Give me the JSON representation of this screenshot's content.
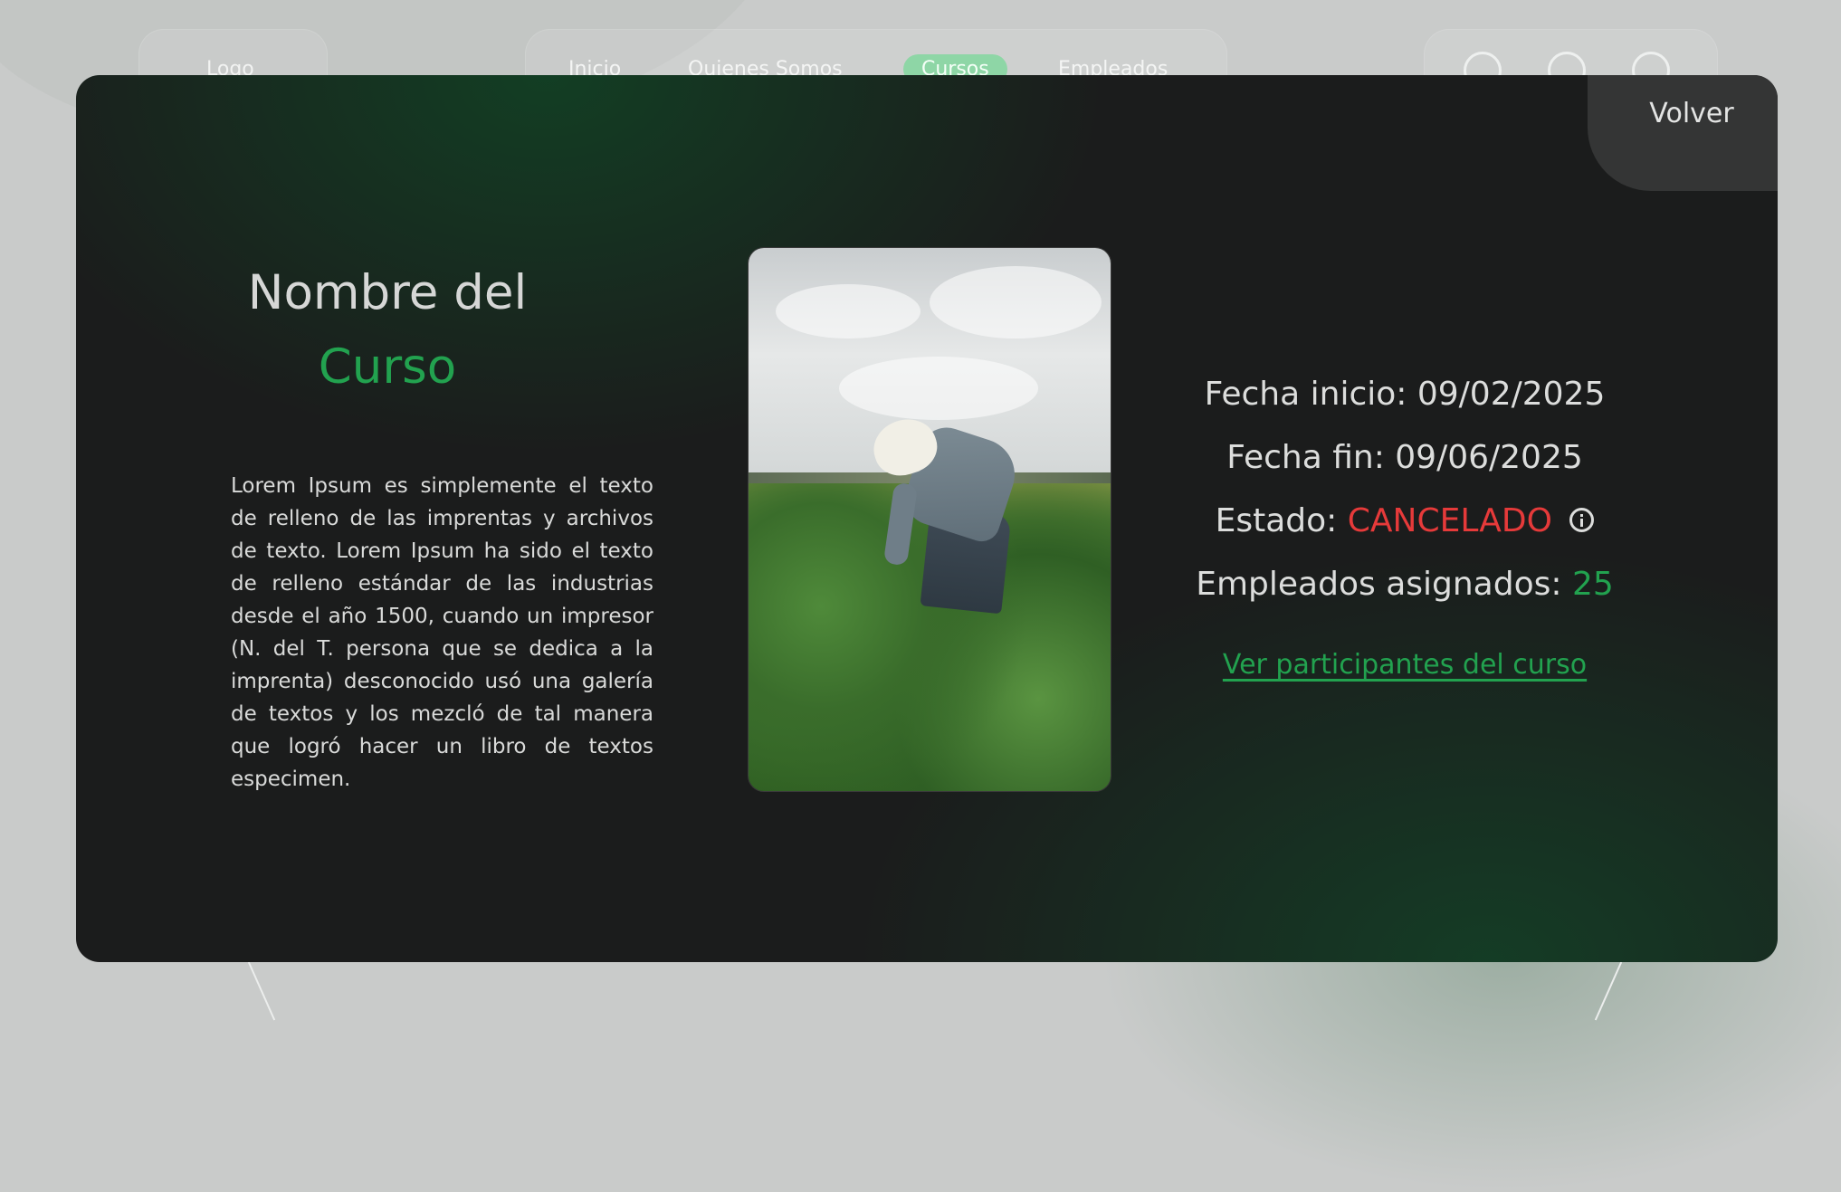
{
  "nav": {
    "logo": "Logo",
    "links": [
      "Inicio",
      "Quienes Somos",
      "Cursos",
      "Empleados"
    ],
    "active_link": "Cursos",
    "icons": [
      "settings-icon",
      "bell-icon",
      "user-icon"
    ]
  },
  "modal": {
    "back_label": "Volver",
    "title_part1": "Nombre del",
    "title_part2": "Curso",
    "description": "Lorem Ipsum es simplemente el texto de relleno de las imprentas y archivos de texto. Lorem Ipsum ha sido el texto de relleno estándar de las industrias desde el año 1500, cuando un impresor (N. del T. persona que se dedica a la imprenta) desconocido usó una galería de textos y los mezcló de tal manera que logró hacer un libro de textos especimen.",
    "details": {
      "start_label": "Fecha inicio:",
      "start_date": "09/02/2025",
      "end_label": "Fecha fin:",
      "end_date": "09/06/2025",
      "status_label": "Estado:",
      "status_value": "CANCELADO",
      "employees_label": "Empleados asignados:",
      "employees_count": "25"
    },
    "participants_link": "Ver participantes del curso"
  },
  "colors": {
    "accent_green": "#22a24f",
    "status_red": "#e63a3a",
    "modal_bg": "#1b1c1c"
  }
}
